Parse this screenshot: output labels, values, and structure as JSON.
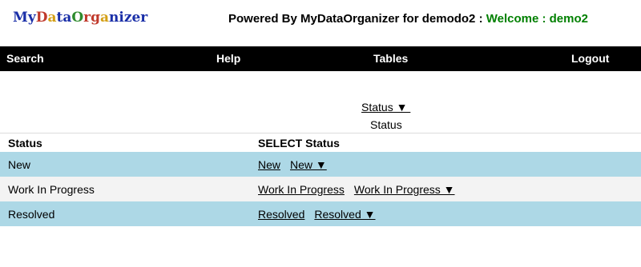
{
  "header": {
    "logo": [
      {
        "text": "My",
        "color": "#1a2fa8"
      },
      {
        "text": "D",
        "color": "#c0392b"
      },
      {
        "text": "a",
        "color": "#d4a017"
      },
      {
        "text": "ta",
        "color": "#1a2fa8"
      },
      {
        "text": "O",
        "color": "#2e8b2e"
      },
      {
        "text": "rg",
        "color": "#c0392b"
      },
      {
        "text": "a",
        "color": "#d4a017"
      },
      {
        "text": "nizer",
        "color": "#1a2fa8"
      }
    ],
    "powered_by": "Powered By MyDataOrganizer for demodo2 : ",
    "welcome": "Welcome : demo2"
  },
  "nav": {
    "search": "Search",
    "help": "Help",
    "tables": "Tables",
    "logout": "Logout"
  },
  "status_dropdown": {
    "label": "Status ▼ ",
    "caption": "Status"
  },
  "table": {
    "headers": [
      "Status",
      "SELECT Status"
    ],
    "rows": [
      {
        "status": "New",
        "link": "New",
        "dropdown": "New ▼",
        "style": "blue"
      },
      {
        "status": "Work In Progress",
        "link": "Work In Progress",
        "dropdown": "Work In Progress ▼",
        "style": "gray"
      },
      {
        "status": "Resolved",
        "link": "Resolved",
        "dropdown": "Resolved ▼",
        "style": "blue"
      }
    ]
  },
  "colors": {
    "navbar": "#000000",
    "row_highlight": "#add8e6",
    "row_alt": "#f3f3f3",
    "welcome": "#008000"
  }
}
